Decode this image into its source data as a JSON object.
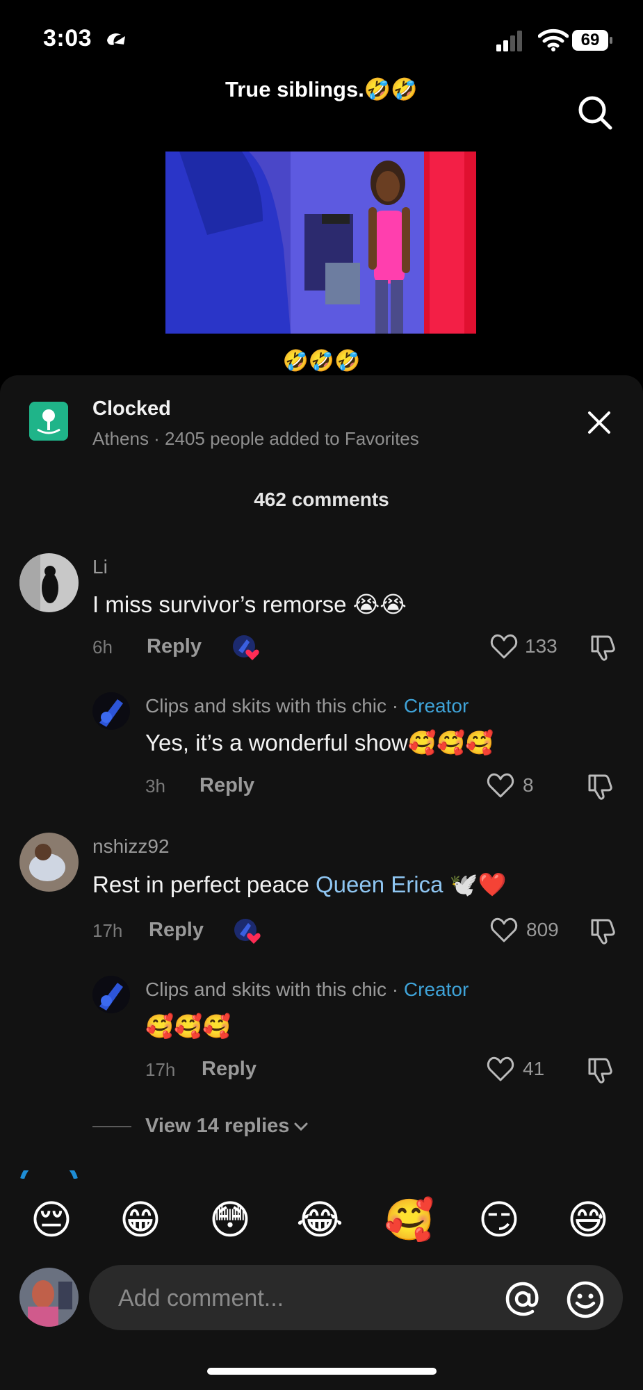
{
  "status": {
    "time": "3:03",
    "battery": "69"
  },
  "post": {
    "caption": "True siblings.🤣🤣",
    "emoji_line": "🤣🤣🤣"
  },
  "place": {
    "name": "Clocked",
    "subtitle": "Athens · 2405 people added to Favorites"
  },
  "comments_count": "462 comments",
  "comments": [
    {
      "username": "Li",
      "text": "I miss survivor’s remorse 😭😭",
      "time": "6h",
      "reply_label": "Reply",
      "likes": "133",
      "reply": {
        "username": "Clips and skits with this chic",
        "separator": " · ",
        "badge": "Creator",
        "text": "Yes, it’s a wonderful show🥰🥰🥰",
        "time": "3h",
        "reply_label": "Reply",
        "likes": "8"
      }
    },
    {
      "username": "nshizz92",
      "text_before": "Rest in perfect peace ",
      "tag": "Queen Erica",
      "text_after": " 🕊️❤️",
      "time": "17h",
      "reply_label": "Reply",
      "likes": "809",
      "reply": {
        "username": "Clips and skits with this chic",
        "separator": " · ",
        "badge": "Creator",
        "text": "🥰🥰🥰",
        "time": "17h",
        "reply_label": "Reply",
        "likes": "41"
      }
    }
  ],
  "view_replies": "View 14 replies",
  "quick_emojis": [
    "😔",
    "😁",
    "😳",
    "😂",
    "🥰",
    "😏",
    "😅"
  ],
  "input": {
    "placeholder": "Add comment..."
  },
  "colors": {
    "sheet_bg": "#121212",
    "creator": "#3fa3d8",
    "tag": "#8fc6f2",
    "place_icon": "#1fb489",
    "liked_heart": "#fe2c55"
  }
}
